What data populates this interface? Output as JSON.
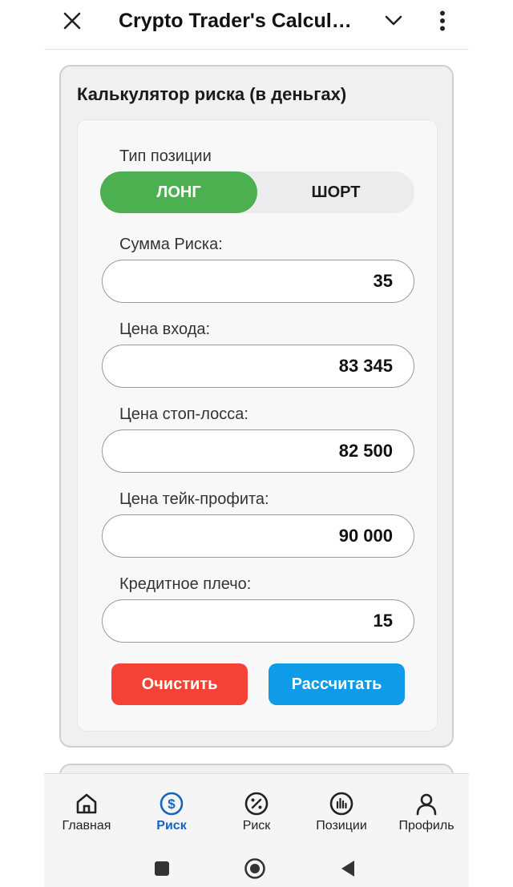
{
  "header": {
    "title": "Crypto Trader's Calcula...",
    "icons": {
      "close": "close-icon",
      "dropdown": "chevron-down-icon",
      "menu": "more-vert-icon"
    }
  },
  "calculator": {
    "title": "Калькулятор риска (в деньгах)",
    "position_type_label": "Тип позиции",
    "position_options": {
      "long": "ЛОНГ",
      "short": "ШОРТ"
    },
    "selected_position": "long",
    "fields": {
      "risk_amount": {
        "label": "Сумма Риска:",
        "value": "35"
      },
      "entry_price": {
        "label": "Цена входа:",
        "value": "83 345"
      },
      "stop_loss": {
        "label": "Цена стоп-лосса:",
        "value": "82 500"
      },
      "take_profit": {
        "label": "Цена тейк-профита:",
        "value": "90 000"
      },
      "leverage": {
        "label": "Кредитное плечо:",
        "value": "15"
      }
    },
    "buttons": {
      "clear": "Очистить",
      "calculate": "Рассчитать"
    }
  },
  "bottom_nav": {
    "items": [
      {
        "label": "Главная",
        "icon": "home-icon"
      },
      {
        "label": "Риск",
        "icon": "dollar-circle-icon",
        "active": true
      },
      {
        "label": "Риск",
        "icon": "percent-circle-icon"
      },
      {
        "label": "Позиции",
        "icon": "bar-chart-icon"
      },
      {
        "label": "Профиль",
        "icon": "user-icon"
      }
    ]
  },
  "colors": {
    "long_active": "#4caf50",
    "clear_button": "#f44336",
    "calculate_button": "#0f9be8",
    "nav_active": "#1565c0"
  }
}
